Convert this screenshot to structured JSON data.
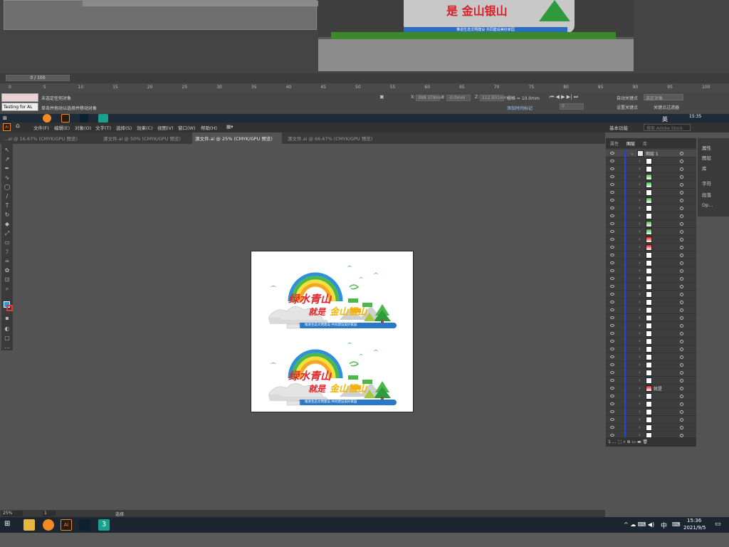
{
  "max": {
    "frame_counter": "0 / 100",
    "ruler_ticks": [
      "0",
      "5",
      "10",
      "15",
      "20",
      "25",
      "30",
      "35",
      "40",
      "45",
      "50",
      "55",
      "60",
      "65",
      "70",
      "75",
      "80",
      "85",
      "90",
      "95",
      "100"
    ],
    "status_1": "未选定任何对象",
    "status_2": "单击并拖动以选择并移动对象",
    "test_label": "Testing for AL",
    "x_label": "X:",
    "x_value": "388.378mm",
    "y_label": "Y:",
    "y_value": "-0.0mm",
    "z_label": "Z:",
    "z_value": "212.931mm",
    "grid_label": "栅格 = 10.0mm",
    "add_time_tag": "添加时间标记",
    "auto_key": "自动关键点",
    "set_key": "设置关键点",
    "selected_object": "选定对象",
    "key_filter": "关键点过滤器",
    "spinner_value": "0",
    "clock": "15:35",
    "sign_text": "是 金山银山",
    "band_text": "推进生态文明建设 共同建设美好家园"
  },
  "ai": {
    "menu": [
      "文件(F)",
      "编辑(E)",
      "对象(O)",
      "文字(T)",
      "选择(S)",
      "效果(C)",
      "视图(V)",
      "窗口(W)",
      "帮助(H)"
    ],
    "workspace": "基本功能",
    "search_placeholder": "搜索 Adobe Stock",
    "tabs": [
      "...ai @ 16.67% (CMYK/GPU 预览)",
      "源文件.ai @ 50% (CMYK/GPU 预览)",
      "源文件.ai @ 25% (CMYK/GPU 预览)",
      "源文件.ai @ 66.67% (CMYK/GPU 预览)"
    ],
    "layers_panel_tabs": [
      "属性",
      "图层",
      "库"
    ],
    "layer_top": "图层 1",
    "layer_text_row": "就是",
    "right_panel": [
      "属性",
      "图层",
      "库",
      "字符",
      "段落",
      "Op..."
    ],
    "zoom": "25%",
    "page_num": "1",
    "status_text": "选择",
    "artwork_line1": "绿水青山",
    "artwork_line2": "就是",
    "artwork_line3": "金山银山",
    "artwork_band": "推进生态文明建设 共同建设美好家园"
  },
  "taskbar": {
    "time": "15:36",
    "date": "2021/9/5",
    "ime": "中",
    "ime2": "英"
  },
  "colors": {
    "rainbow": [
      "#e8322b",
      "#f5a623",
      "#f3e03a",
      "#4cb848",
      "#2f8fd8"
    ],
    "title_red": "#e3262b",
    "title_yellow": "#f2b705",
    "band_blue": "#2a78c8",
    "tree_green": "#2e9b3d"
  }
}
